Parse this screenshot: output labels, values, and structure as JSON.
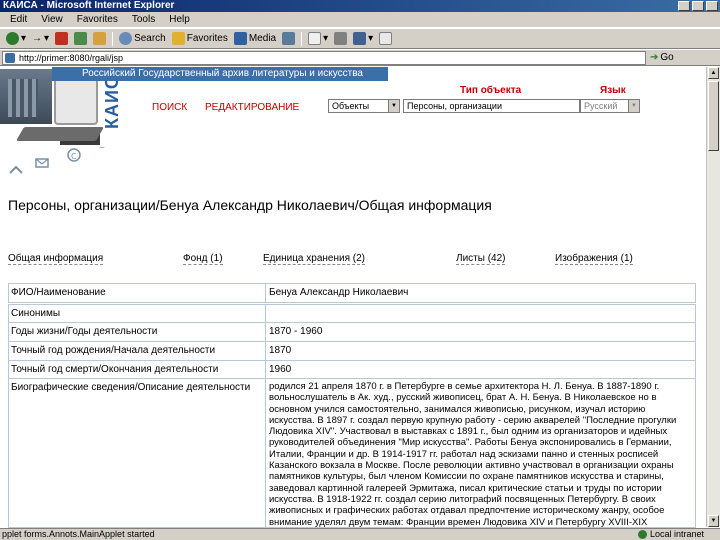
{
  "window": {
    "title": "КАИСА - Microsoft Internet Explorer"
  },
  "menu": [
    "Edit",
    "View",
    "Favorites",
    "Tools",
    "Help"
  ],
  "toolbar": {
    "search_label": "Search",
    "favorites_label": "Favorites",
    "media_label": "Media"
  },
  "address": {
    "url": "http://primer:8080/rgali/jsp",
    "go_label": "Go"
  },
  "site": {
    "logo_text": "КАИСА",
    "archive_name": "Российский Государственный архив литературы и искусства",
    "nav_search": "ПОИСК",
    "nav_edit": "РЕДАКТИРОВАНИЕ",
    "object_type_label": "Тип объекта",
    "language_label": "Язык",
    "select_objects": "Объекты",
    "select_persons": "Персоны, организации",
    "select_language": "Русский"
  },
  "page": {
    "title": "Персоны, организации/Бенуа Александр Николаевич/Общая информация"
  },
  "tabs": [
    "Общая информация",
    "Фонд (1)",
    "Единица хранения (2)",
    "Листы (42)",
    "Изображения (1)"
  ],
  "rows": [
    {
      "label": "ФИО/Наименование",
      "value": "Бенуа Александр Николаевич"
    },
    {
      "label": "Синонимы",
      "value": ""
    },
    {
      "label": "Годы жизни/Годы деятельности",
      "value": "1870 - 1960"
    },
    {
      "label": "Точный год рождения/Начала деятельности",
      "value": "1870"
    },
    {
      "label": "Точный год смерти/Окончания деятельности",
      "value": "1960"
    },
    {
      "label": "Биографические сведения/Описание деятельности",
      "value": "родился 21 апреля 1870 г. в Петербурге в семье архитектора Н. Л. Бенуа. В 1887-1890 г. вольнослушатель в Ак. худ., русский живописец, брат А. Н. Бенуа. В Николаевское но в основном учился самостоятельно, занимался живописью, рисунком, изучал историю искусства. В 1897 г. создал первую крупную работу - серию акварелей \"Последние прогулки Людовика XIV\". Участвовал в выставках с 1891 г., был одним из организаторов и идейных руководителей объединения \"Мир искусства\". Работы Бенуа экспонировались в Германии, Италии, Франции и др. В 1914-1917 гг. работал над эскизами панно и стенных росписей Казанского вокзала в Москве. После революции активно участвовал в организации охраны памятников культуры, был членом Комиссии по охране памятников искусства и старины, заведовал картинной галереей Эрмитажа, писал критические статьи и труды по истории искусства. В 1918-1922 гг. создал серию литографий посвященных Петербургу. В своих живописных и графических работах отдавал предпочтение историческому жанру, особое внимание уделял двум темам: Франции времен Людовика XIV и Петербургу XVIII-XIX"
    }
  ],
  "status": {
    "text": "pplet forms.Annots.MainApplet started",
    "zone": "Local intranet"
  },
  "colors": {
    "banner": "#3a6fa8",
    "nav_red": "#c00000",
    "title_bar": "#0a246a"
  }
}
